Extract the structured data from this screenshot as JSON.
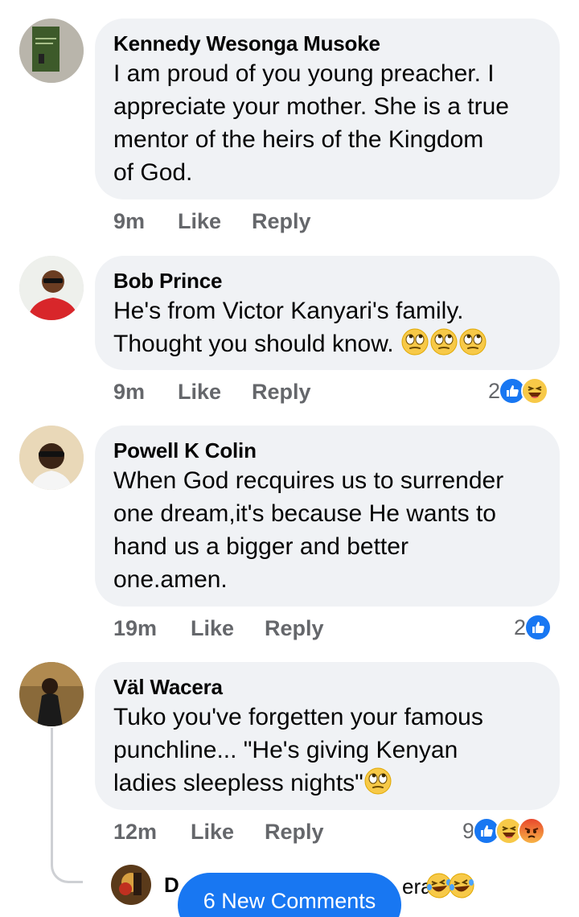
{
  "comments": [
    {
      "name": "Kennedy Wesonga Musoke",
      "lines": [
        "I am proud of you young preacher. I",
        "appreciate your mother. She is a true",
        "mentor of the heirs of the Kingdom",
        "of God."
      ],
      "time": "9m",
      "like_label": "Like",
      "reply_label": "Reply"
    },
    {
      "name": "Bob Prince",
      "lines": [
        "He's from Victor Kanyari's family.",
        "Thought you should know. "
      ],
      "emoji": [
        "eye-roll-emoji",
        "eye-roll-emoji",
        "eye-roll-emoji"
      ],
      "time": "9m",
      "like_label": "Like",
      "reply_label": "Reply",
      "reaction_count": "2",
      "reactions": [
        "like-reaction",
        "haha-reaction"
      ]
    },
    {
      "name": "Powell K Colin",
      "lines": [
        "When God recquires us to surrender",
        "one dream,it's because He wants to",
        "hand us a bigger and better",
        "one.amen."
      ],
      "time": "19m",
      "like_label": "Like",
      "reply_label": "Reply",
      "reaction_count": "2",
      "reactions": [
        "like-reaction"
      ]
    },
    {
      "name": "Väl Wacera",
      "lines": [
        "Tuko you've forgetten your famous",
        "punchline... \"He's giving Kenyan",
        "ladies sleepless nights\""
      ],
      "emoji": [
        "eye-roll-emoji"
      ],
      "time": "12m",
      "like_label": "Like",
      "reply_label": "Reply",
      "reaction_count": "9",
      "reactions": [
        "like-reaction",
        "haha-reaction",
        "angry-reaction"
      ]
    }
  ],
  "reply_preview": {
    "name_start": "D",
    "name_end": "era",
    "emoji": [
      "laugh-cry-emoji",
      "laugh-cry-emoji"
    ]
  },
  "new_comments_label": "6 New Comments",
  "colors": {
    "accent": "#1877f2",
    "bubble": "#f0f2f5",
    "meta": "#65676b"
  }
}
